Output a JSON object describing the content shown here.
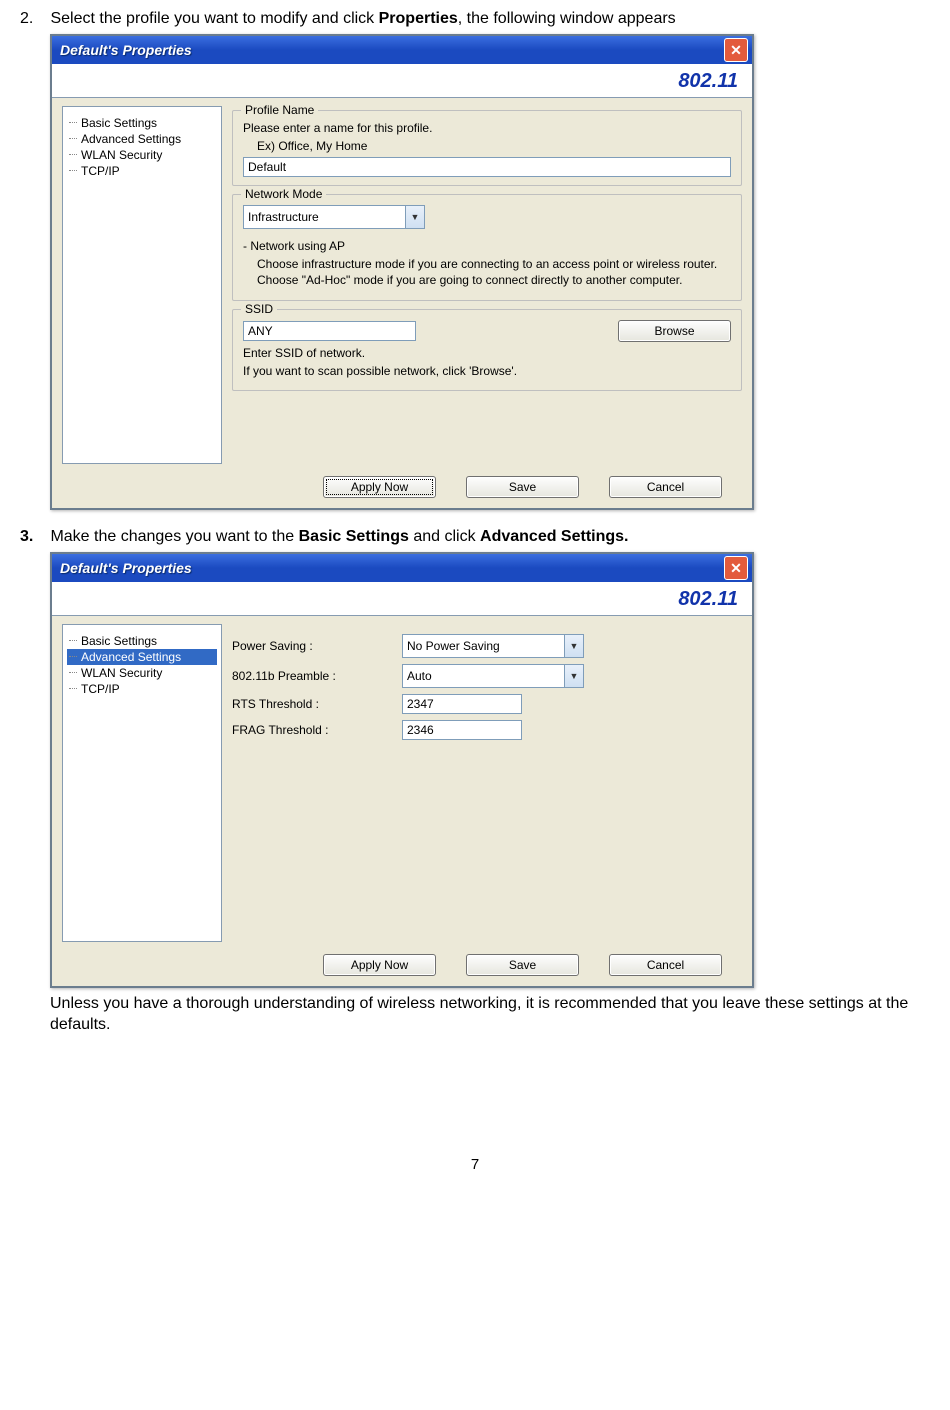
{
  "step2": {
    "num": "2.",
    "text_pre": "Select the profile you want to modify and click ",
    "text_bold": "Properties",
    "text_post": ", the following window appears"
  },
  "step3": {
    "num": "3.",
    "text_pre": "Make the changes you want to the ",
    "bold1": "Basic Settings",
    "mid": " and click ",
    "bold2": "Advanced Settings."
  },
  "post_text": "Unless you have a thorough understanding of wireless networking, it is recommended that you leave these settings at the defaults.",
  "page_number": "7",
  "window1": {
    "title": "Default's Properties",
    "banner": "802.11",
    "tree": [
      "Basic Settings",
      "Advanced Settings",
      "WLAN Security",
      "TCP/IP"
    ],
    "profile_group": {
      "title": "Profile Name",
      "hint1": "Please enter a name for this profile.",
      "hint2": "Ex) Office, My Home",
      "value": "Default"
    },
    "network_group": {
      "title": "Network Mode",
      "value": "Infrastructure",
      "sub_title": "- Network using AP",
      "desc": "Choose infrastructure mode if you are connecting to an access point or wireless router. Choose \"Ad-Hoc\" mode if you are going to connect directly to another computer."
    },
    "ssid_group": {
      "title": "SSID",
      "value": "ANY",
      "browse": "Browse",
      "hint1": "Enter SSID of network.",
      "hint2": "If you want to scan possible network, click 'Browse'."
    },
    "buttons": {
      "apply": "Apply Now",
      "save": "Save",
      "cancel": "Cancel"
    }
  },
  "window2": {
    "title": "Default's Properties",
    "banner": "802.11",
    "tree": [
      "Basic Settings",
      "Advanced Settings",
      "WLAN Security",
      "TCP/IP"
    ],
    "selected_index": 1,
    "fields": {
      "power_label": "Power Saving :",
      "power_value": "No Power Saving",
      "preamble_label": "802.11b Preamble :",
      "preamble_value": "Auto",
      "rts_label": "RTS Threshold :",
      "rts_value": "2347",
      "frag_label": "FRAG Threshold :",
      "frag_value": "2346"
    },
    "buttons": {
      "apply": "Apply Now",
      "save": "Save",
      "cancel": "Cancel"
    }
  }
}
